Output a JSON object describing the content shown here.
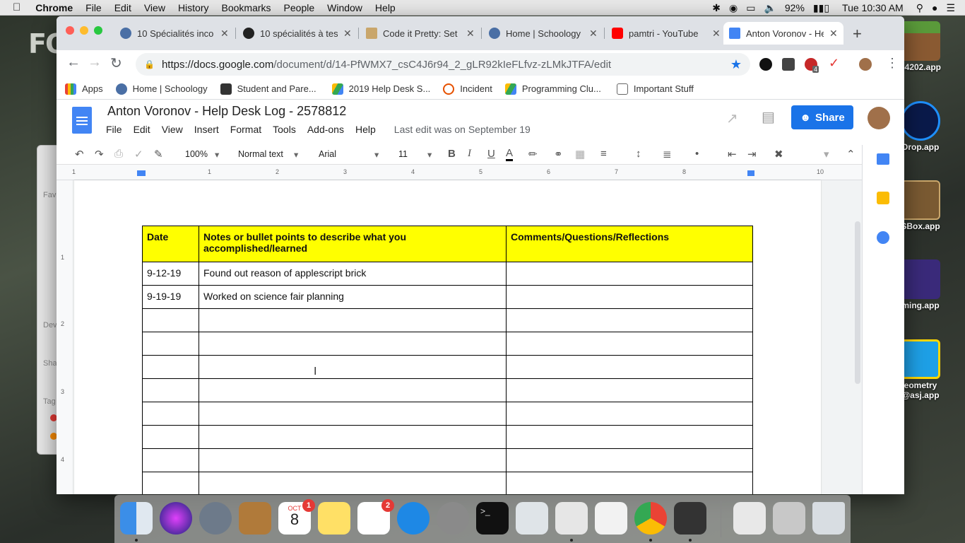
{
  "menubar": {
    "app": "Chrome",
    "items": [
      "File",
      "Edit",
      "View",
      "History",
      "Bookmarks",
      "People",
      "Window",
      "Help"
    ],
    "battery": "92%",
    "clock": "Tue 10:30 AM"
  },
  "desktop": {
    "wall_text": "FO",
    "icons": [
      "54202.app",
      "Drop.app",
      "SBox.app",
      "ming.app",
      "eometry",
      "@asj.app"
    ],
    "finder_labels": [
      "Fav",
      "Dev",
      "Sha",
      "Tag"
    ]
  },
  "tabs": [
    {
      "title": "10 Spécialités inco",
      "color": "#4a6fa5"
    },
    {
      "title": "10 spécialités à tes",
      "color": "#222222"
    },
    {
      "title": "Code it Pretty: Set",
      "color": "#c9a66b"
    },
    {
      "title": "Home | Schoology",
      "color": "#4a6fa5"
    },
    {
      "title": "pamtri - YouTube",
      "color": "#ff0000"
    },
    {
      "title": "Anton Voronov - He",
      "color": "#4285f4"
    }
  ],
  "omnibox": {
    "host": "https://docs.google.com",
    "path": "/document/d/14-PfWMX7_csC4J6r94_2_gLR92kIeFLfvz-zLMkJTFA/edit"
  },
  "extensions": {
    "abp_count": "4"
  },
  "bookmarks": [
    "Apps",
    "Home | Schoology",
    "Student and Pare...",
    "2019 Help Desk S...",
    "Incident",
    "Programming Clu...",
    "Important Stuff"
  ],
  "doc": {
    "title": "Anton Voronov - Help Desk Log - 2578812",
    "menu": [
      "File",
      "Edit",
      "View",
      "Insert",
      "Format",
      "Tools",
      "Add-ons",
      "Help"
    ],
    "last_edit": "Last edit was on September 19",
    "share": "Share"
  },
  "format": {
    "zoom": "100%",
    "style": "Normal text",
    "font": "Arial",
    "size": "11"
  },
  "ruler": [
    "1",
    "1",
    "2",
    "3",
    "4",
    "5",
    "6",
    "7",
    "8",
    "10"
  ],
  "vruler": [
    "1",
    "2",
    "3",
    "4"
  ],
  "table": {
    "headers": [
      "Date",
      "Notes or bullet points to describe what you accomplished/learned",
      "Comments/Questions/Reflections"
    ],
    "rows": [
      [
        "9-12-19",
        "Found out reason of applescript brick",
        ""
      ],
      [
        "9-19-19",
        "Worked on science fair planning",
        ""
      ],
      [
        "",
        "",
        ""
      ],
      [
        "",
        "",
        ""
      ],
      [
        "",
        "",
        ""
      ],
      [
        "",
        "",
        ""
      ],
      [
        "",
        "",
        ""
      ],
      [
        "",
        "",
        ""
      ],
      [
        "",
        "",
        ""
      ],
      [
        "",
        "",
        ""
      ]
    ]
  },
  "dock": {
    "calendar_month": "OCT",
    "calendar_day": "8",
    "calendar_badge": "1",
    "reminders_badge": "2"
  }
}
